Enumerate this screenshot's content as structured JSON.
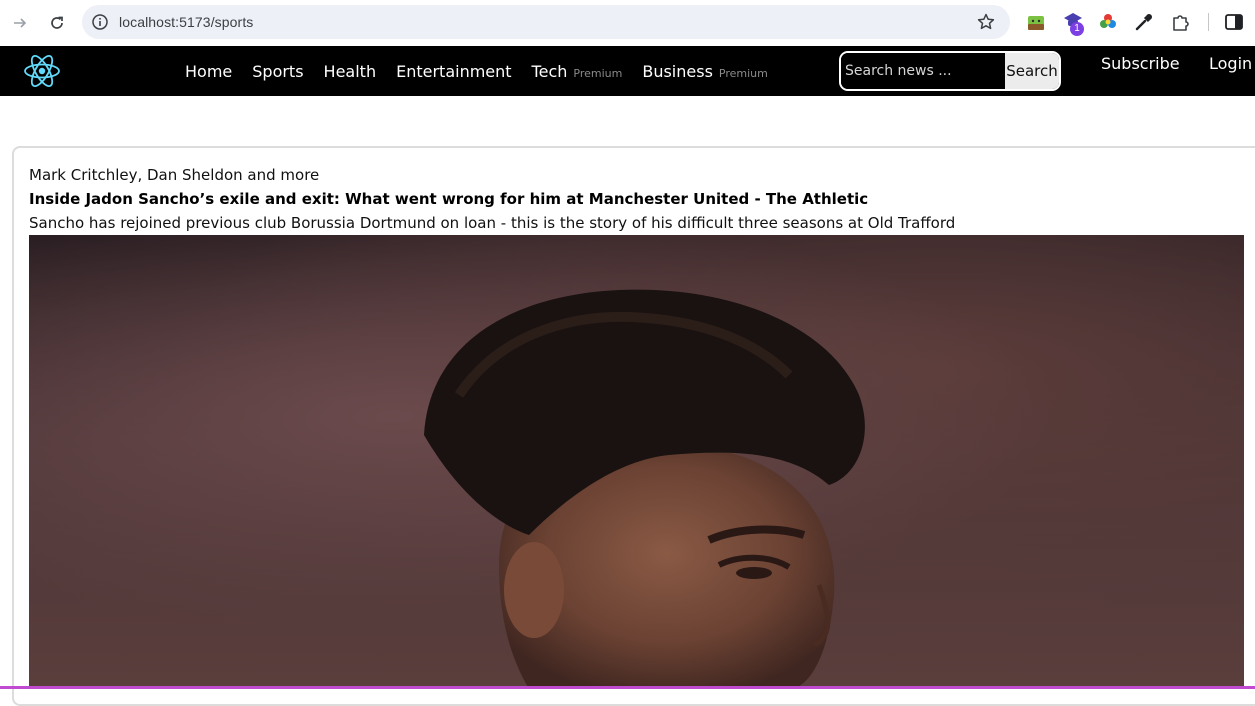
{
  "browser": {
    "url": "localhost:5173/sports",
    "ext_badge": "1"
  },
  "site": {
    "nav": [
      {
        "label": "Home",
        "premium": ""
      },
      {
        "label": "Sports",
        "premium": ""
      },
      {
        "label": "Health",
        "premium": ""
      },
      {
        "label": "Entertainment",
        "premium": ""
      },
      {
        "label": "Tech",
        "premium": "Premium"
      },
      {
        "label": "Business",
        "premium": "Premium"
      }
    ],
    "search": {
      "placeholder": "Search news ...",
      "button_label": "Search"
    },
    "subscribe_label": "Subscribe",
    "login_label": "Login"
  },
  "article": {
    "author": "Mark Critchley, Dan Sheldon and more",
    "title": "Inside Jadon Sancho’s exile and exit: What went wrong for him at Manchester United - The Athletic",
    "description": "Sancho has rejoined previous club Borussia Dortmund on loan - this is the story of his difficult three seasons at Old Trafford"
  },
  "colors": {
    "header_bg": "#000000",
    "logo": "#61dafb",
    "omnibox_bg": "#eef0f8"
  }
}
